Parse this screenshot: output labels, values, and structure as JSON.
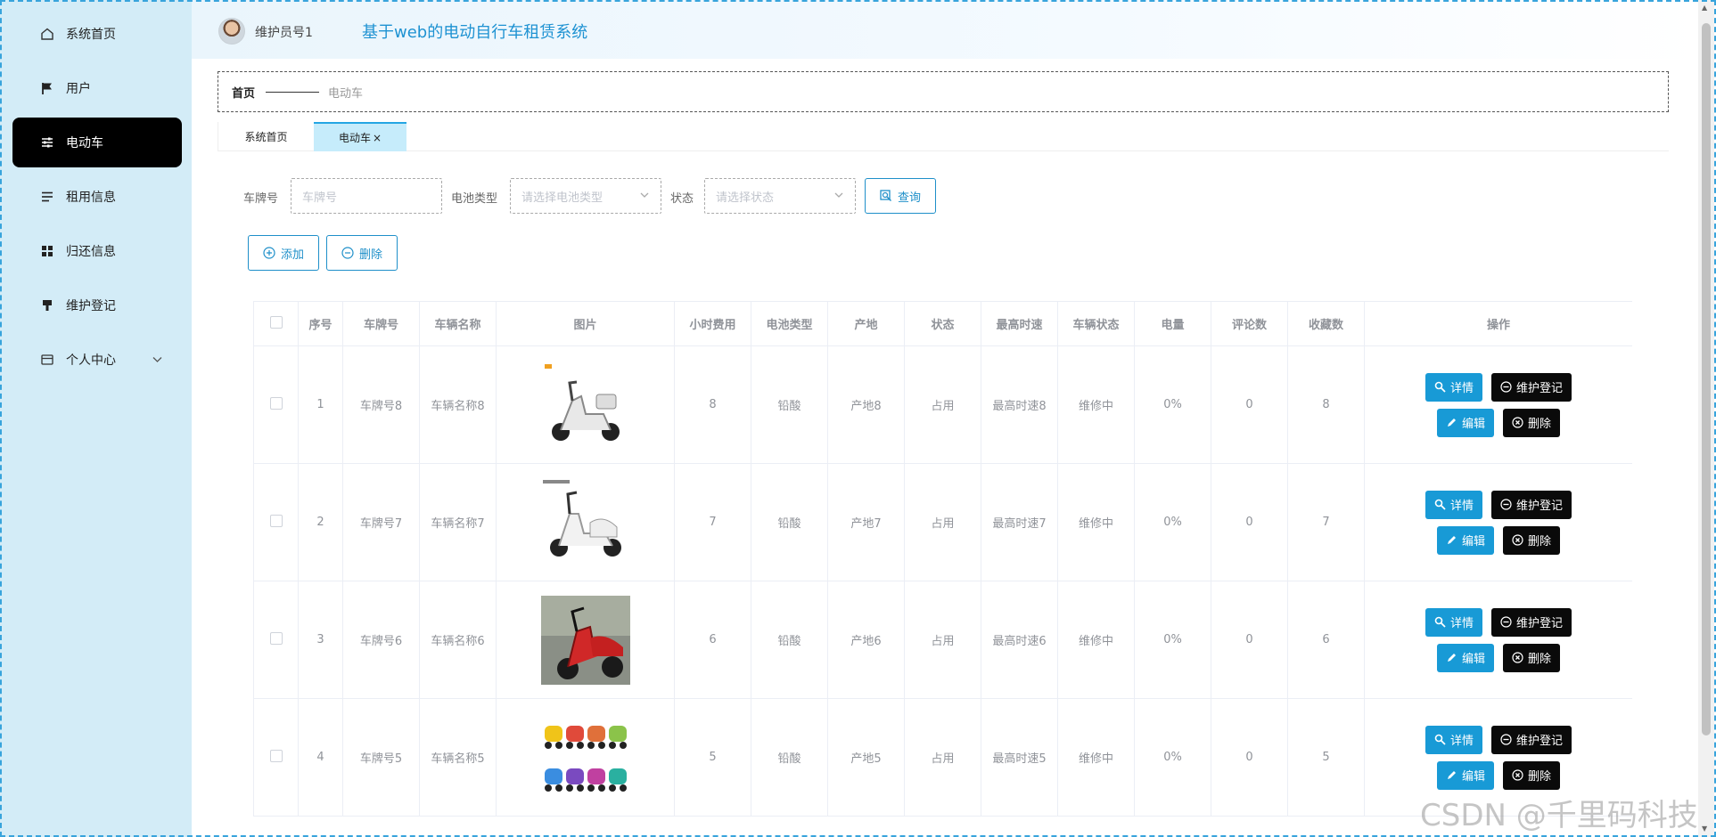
{
  "header": {
    "username": "维护员号1",
    "system_title": "基于web的电动自行车租赁系统"
  },
  "sidebar": {
    "items": [
      {
        "label": "系统首页",
        "icon": "home-icon"
      },
      {
        "label": "用户",
        "icon": "flag-icon"
      },
      {
        "label": "电动车",
        "icon": "sliders-icon",
        "active": true
      },
      {
        "label": "租用信息",
        "icon": "list-icon"
      },
      {
        "label": "归还信息",
        "icon": "grid-icon"
      },
      {
        "label": "维护登记",
        "icon": "brush-icon"
      },
      {
        "label": "个人中心",
        "icon": "card-icon",
        "has_submenu": true
      }
    ]
  },
  "breadcrumb": {
    "home": "首页",
    "current": "电动车"
  },
  "tabs": [
    {
      "label": "系统首页"
    },
    {
      "label": "电动车",
      "close": "×",
      "active": true
    }
  ],
  "search": {
    "plate_label": "车牌号",
    "plate_placeholder": "车牌号",
    "battery_label": "电池类型",
    "battery_placeholder": "请选择电池类型",
    "status_label": "状态",
    "status_placeholder": "请选择状态",
    "query_button": "查询"
  },
  "actions": {
    "add": "添加",
    "delete": "删除"
  },
  "table": {
    "columns": [
      "序号",
      "车牌号",
      "车辆名称",
      "图片",
      "小时费用",
      "电池类型",
      "产地",
      "状态",
      "最高时速",
      "车辆状态",
      "电量",
      "评论数",
      "收藏数",
      "操作"
    ],
    "row_buttons": {
      "detail": "详情",
      "maintain": "维护登记",
      "edit": "编辑",
      "delete": "删除"
    },
    "rows": [
      {
        "index": "1",
        "plate": "车牌号8",
        "name": "车辆名称8",
        "image": "white-scooter-with-trunk",
        "hourly_fee": "8",
        "battery": "铅酸",
        "origin": "产地8",
        "status": "占用",
        "max_speed": "最高时速8",
        "vehicle_status": "维修中",
        "charge": "0%",
        "comments": "0",
        "favorites": "8"
      },
      {
        "index": "2",
        "plate": "车牌号7",
        "name": "车辆名称7",
        "image": "white-scooter",
        "hourly_fee": "7",
        "battery": "铅酸",
        "origin": "产地7",
        "status": "占用",
        "max_speed": "最高时速7",
        "vehicle_status": "维修中",
        "charge": "0%",
        "comments": "0",
        "favorites": "7"
      },
      {
        "index": "3",
        "plate": "车牌号6",
        "name": "车辆名称6",
        "image": "red-scooter-photo",
        "hourly_fee": "6",
        "battery": "铅酸",
        "origin": "产地6",
        "status": "占用",
        "max_speed": "最高时速6",
        "vehicle_status": "维修中",
        "charge": "0%",
        "comments": "0",
        "favorites": "6"
      },
      {
        "index": "4",
        "plate": "车牌号5",
        "name": "车辆名称5",
        "image": "colorful-scooters-grid",
        "hourly_fee": "5",
        "battery": "铅酸",
        "origin": "产地5",
        "status": "占用",
        "max_speed": "最高时速5",
        "vehicle_status": "维修中",
        "charge": "0%",
        "comments": "0",
        "favorites": "5"
      }
    ]
  },
  "watermark": "CSDN @千里码科技",
  "colors": {
    "sidebar_bg": "#d3ecf7",
    "active_menu_bg": "#000000",
    "primary": "#189ad6",
    "title": "#1e92d2",
    "tab_active_bg": "#c6ecfb"
  }
}
